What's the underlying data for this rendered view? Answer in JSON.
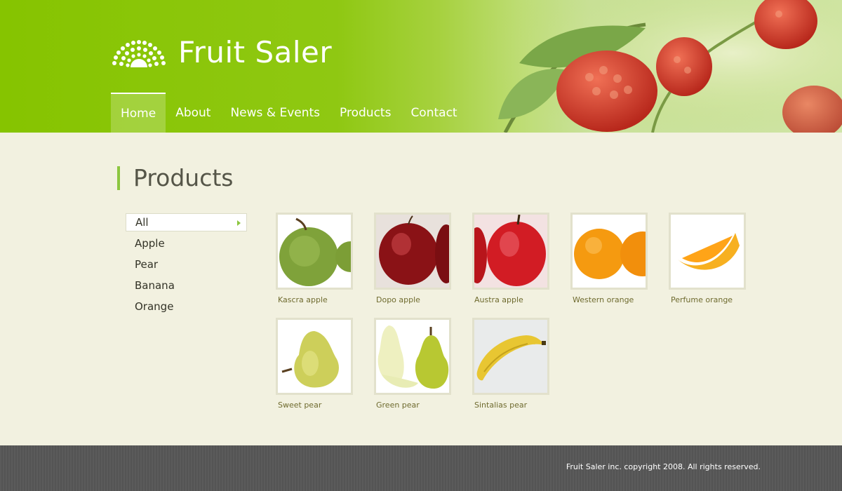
{
  "brand": {
    "name": "Fruit Saler"
  },
  "nav": [
    {
      "label": "Home",
      "active": true
    },
    {
      "label": "About"
    },
    {
      "label": "News & Events"
    },
    {
      "label": "Products"
    },
    {
      "label": "Contact"
    }
  ],
  "page": {
    "title": "Products"
  },
  "categories": [
    {
      "label": "All",
      "active": true
    },
    {
      "label": "Apple"
    },
    {
      "label": "Pear"
    },
    {
      "label": "Banana"
    },
    {
      "label": "Orange"
    }
  ],
  "products": [
    {
      "name": "Kascra apple",
      "image": "green-apple"
    },
    {
      "name": "Dopo apple",
      "image": "dark-red-apple"
    },
    {
      "name": "Austra apple",
      "image": "red-apple"
    },
    {
      "name": "Western orange",
      "image": "orange"
    },
    {
      "name": "Perfume orange",
      "image": "orange-slice"
    },
    {
      "name": "Sweet pear",
      "image": "pear"
    },
    {
      "name": "Green pear",
      "image": "green-pear-halves"
    },
    {
      "name": "Sintalias pear",
      "image": "banana"
    }
  ],
  "footer": {
    "copyright": "Fruit Saler inc. copyright 2008. All rights reserved."
  },
  "colors": {
    "header_green": "#86c400",
    "accent": "#8cc63f",
    "background": "#f2f1e0",
    "footer": "#585858"
  }
}
